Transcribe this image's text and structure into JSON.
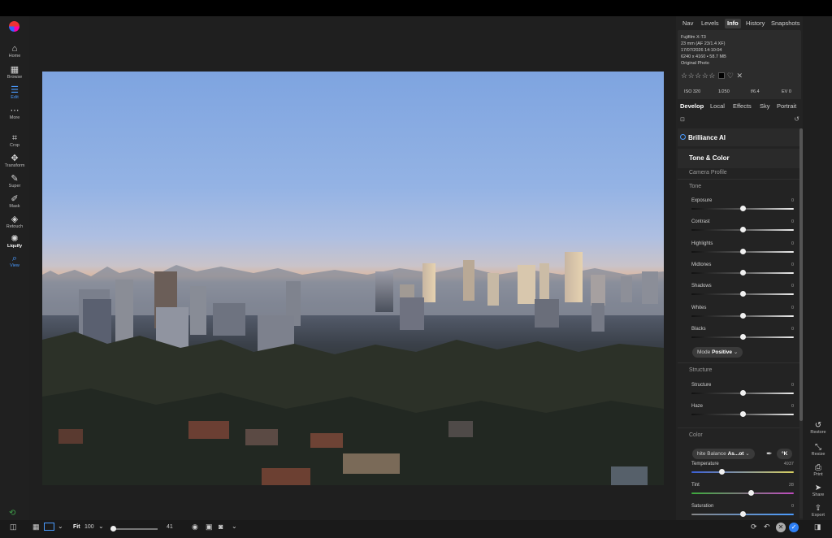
{
  "left_tools": [
    {
      "key": "home",
      "label": "Home",
      "icon": "⌂",
      "icon_name": "home-icon"
    },
    {
      "key": "browse",
      "label": "Browse",
      "icon": "▦",
      "icon_name": "browse-grid-icon"
    },
    {
      "key": "edit",
      "label": "Edit",
      "icon": "☰",
      "icon_name": "edit-sliders-icon"
    },
    {
      "key": "more",
      "label": "More",
      "icon": "⋯",
      "icon_name": "more-icon"
    },
    {
      "key": "crop",
      "label": "Crop",
      "icon": "⌗",
      "icon_name": "crop-icon"
    },
    {
      "key": "transform",
      "label": "Transform",
      "icon": "✥",
      "icon_name": "transform-icon"
    },
    {
      "key": "super",
      "label": "Super",
      "icon": "✎",
      "icon_name": "super-icon"
    },
    {
      "key": "mask",
      "label": "Mask",
      "icon": "✐",
      "icon_name": "mask-brush-icon"
    },
    {
      "key": "retouch",
      "label": "Retouch",
      "icon": "◈",
      "icon_name": "retouch-icon"
    },
    {
      "key": "liquify",
      "label": "Liquify",
      "icon": "✺",
      "icon_name": "liquify-icon"
    },
    {
      "key": "view",
      "label": "View",
      "icon": "⌕",
      "icon_name": "view-zoom-icon"
    }
  ],
  "top_tabs": [
    "Nav",
    "Levels",
    "Info",
    "History",
    "Snapshots"
  ],
  "active_top_tab": "Info",
  "info": {
    "camera": "Fujifilm X-T3",
    "lens": "23 mm (AF 23/1.4 XF)",
    "datetime": "17/07/2026 14:10:04",
    "size": "6240 x 4160 • 58.7 MB",
    "status": "Original Photo",
    "stars": "☆☆☆☆☆",
    "iso": "ISO 320",
    "shutter": "1/250",
    "aperture": "f/6.4",
    "ev": "EV 0"
  },
  "develop_tabs": [
    "Develop",
    "Local",
    "Effects",
    "Sky",
    "Portrait"
  ],
  "brilliance_label": "Brilliance AI",
  "tone_color_label": "Tone & Color",
  "camera_profile_label": "Camera Profile",
  "tone_section": "Tone",
  "tone_sliders": [
    {
      "label": "Exposure",
      "value": "0",
      "level": 0.5
    },
    {
      "label": "Contrast",
      "value": "0",
      "level": 0.5
    },
    {
      "label": "Highlights",
      "value": "0",
      "level": 0.5
    },
    {
      "label": "Midtones",
      "value": "0",
      "level": 0.5
    },
    {
      "label": "Shadows",
      "value": "0",
      "level": 0.5
    },
    {
      "label": "Whites",
      "value": "0",
      "level": 0.5
    },
    {
      "label": "Blacks",
      "value": "0",
      "level": 0.5
    }
  ],
  "mode_label": "Mode",
  "mode_value": "Positive",
  "structure_section": "Structure",
  "structure_sliders": [
    {
      "label": "Structure",
      "value": "0",
      "level": 0.5
    },
    {
      "label": "Haze",
      "value": "0",
      "level": 0.5
    }
  ],
  "color_section": "Color",
  "white_balance_label": "hite Balance",
  "white_balance_value": "As...ot",
  "kelvin_label": "°K",
  "color_sliders": [
    {
      "label": "Temperature",
      "value": "4937",
      "level": 0.29
    },
    {
      "label": "Tint",
      "value": "28",
      "level": 0.58
    },
    {
      "label": "Saturation",
      "value": "0",
      "level": 0.5
    }
  ],
  "right_tools": [
    {
      "label": "Restore",
      "icon": "↺",
      "icon_name": "restore-icon"
    },
    {
      "label": "Resize",
      "icon": "⤡",
      "icon_name": "resize-icon"
    },
    {
      "label": "Print",
      "icon": "⎙",
      "icon_name": "print-icon"
    },
    {
      "label": "Share",
      "icon": "➤",
      "icon_name": "share-icon"
    },
    {
      "label": "Export",
      "icon": "⇪",
      "icon_name": "export-icon"
    }
  ],
  "bottom": {
    "fit_label": "Fit",
    "zoom_value": "100",
    "slider_value": "41",
    "zoom_level": 0.05
  }
}
